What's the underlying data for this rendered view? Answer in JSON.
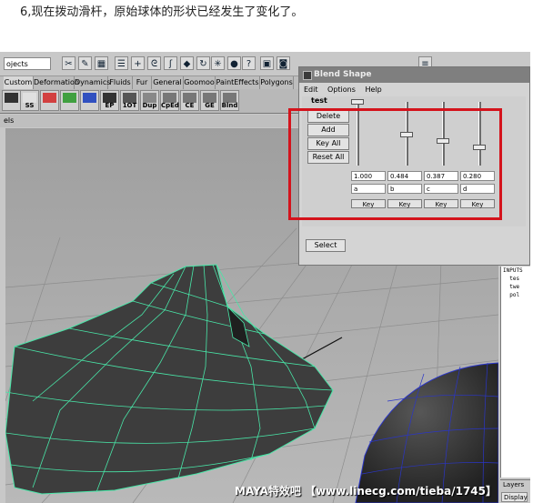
{
  "caption": "6,现在拨动滑杆，原始球体的形状已经发生了变化了。",
  "toolbar": {
    "project_field": "ojects",
    "icons": [
      "scissors-icon",
      "paint-icon",
      "grid-icon",
      "list-icon",
      "plus-icon",
      "lasso-icon",
      "curve-icon",
      "cube-icon",
      "rotate-icon",
      "snowflake-icon",
      "globe-icon",
      "help-icon",
      "lock-icon",
      "camera-icon",
      "menu-icon"
    ]
  },
  "shelf_tabs": [
    "Custom",
    "Deformation",
    "Dynamics",
    "Fluids",
    "Fur",
    "General",
    "Goomoo",
    "PaintEffects",
    "Polygons"
  ],
  "shelf_items": [
    "",
    "SS",
    "",
    "",
    "",
    "EP",
    "1OT",
    "Dup",
    "CpEd",
    "CE",
    "GE",
    "Blnd"
  ],
  "viewport": {
    "panel_menu": "els"
  },
  "blend_shape": {
    "title": "Blend Shape",
    "menu": [
      "Edit",
      "Options",
      "Help"
    ],
    "node_name": "test",
    "buttons": [
      "Delete",
      "Add",
      "Key All",
      "Reset All"
    ],
    "sliders": [
      {
        "value": "1.000",
        "target": "a",
        "level": 1.0,
        "key": "Key"
      },
      {
        "value": "0.484",
        "target": "b",
        "level": 0.484,
        "key": "Key"
      },
      {
        "value": "0.387",
        "target": "c",
        "level": 0.387,
        "key": "Key"
      },
      {
        "value": "0.280",
        "target": "d",
        "level": 0.28,
        "key": "Key"
      }
    ],
    "select_label": "Select"
  },
  "script_editor": {
    "lines": [
      "INPUTS",
      "  tes",
      "  twe",
      "  pol"
    ]
  },
  "layers": {
    "label": "Layers",
    "display": "Display"
  },
  "watermark": "MAYA特效吧  【www.linecg.com/tieba/1745】",
  "colors": {
    "highlight_box": "#d4131c",
    "wireframe": "#49e6a8",
    "mesh": "#3c3c3c"
  }
}
